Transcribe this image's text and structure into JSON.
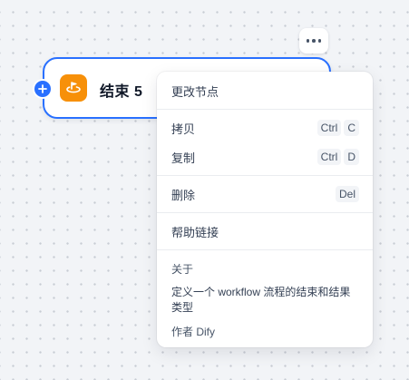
{
  "node": {
    "title": "结束 5",
    "icon": "end-node-icon",
    "accent_color": "#2970ff",
    "icon_color": "#f79009"
  },
  "toolbar": {
    "more_icon": "more-horizontal-icon"
  },
  "menu": {
    "change_node": "更改节点",
    "copy": {
      "label": "拷贝",
      "shortcut": [
        "Ctrl",
        "C"
      ]
    },
    "duplicate": {
      "label": "复制",
      "shortcut": [
        "Ctrl",
        "D"
      ]
    },
    "delete": {
      "label": "删除",
      "shortcut": [
        "Del"
      ]
    },
    "help_link": "帮助链接",
    "about": {
      "title": "关于",
      "description": "定义一个 workflow 流程的结束和结果类型",
      "author": "作者 Dify"
    }
  }
}
